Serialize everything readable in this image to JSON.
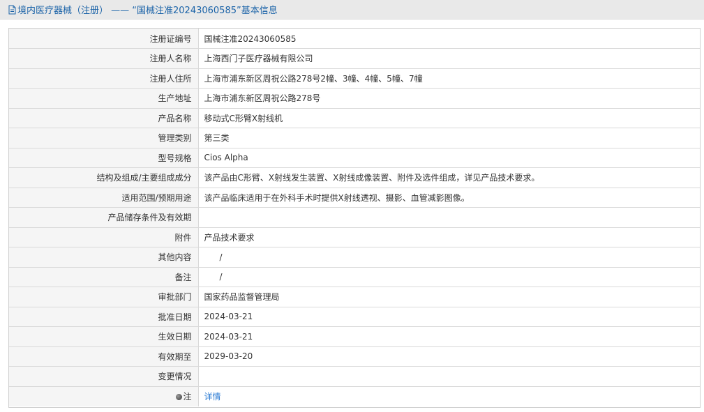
{
  "header": {
    "title": "境内医疗器械（注册） —— “国械注准20243060585”基本信息",
    "accent_color": "#1b63a8"
  },
  "rows": [
    {
      "label": "注册证编号",
      "value": "国械注准20243060585"
    },
    {
      "label": "注册人名称",
      "value": "上海西门子医疗器械有限公司"
    },
    {
      "label": "注册人住所",
      "value": "上海市浦东新区周祝公路278号2幢、3幢、4幢、5幢、7幢"
    },
    {
      "label": "生产地址",
      "value": "上海市浦东新区周祝公路278号"
    },
    {
      "label": "产品名称",
      "value": "移动式C形臂X射线机"
    },
    {
      "label": "管理类别",
      "value": "第三类"
    },
    {
      "label": "型号规格",
      "value": "Cios Alpha"
    },
    {
      "label": "结构及组成/主要组成成分",
      "value": "该产品由C形臂、X射线发生装置、X射线成像装置、附件及选件组成，详见产品技术要求。"
    },
    {
      "label": "适用范围/预期用途",
      "value": "该产品临床适用于在外科手术时提供X射线透视、摄影、血管减影图像。"
    },
    {
      "label": "产品储存条件及有效期",
      "value": ""
    },
    {
      "label": "附件",
      "value": "产品技术要求"
    },
    {
      "label": "其他内容",
      "value": "/"
    },
    {
      "label": "备注",
      "value": "/"
    },
    {
      "label": "审批部门",
      "value": "国家药品监督管理局"
    },
    {
      "label": "批准日期",
      "value": "2024-03-21"
    },
    {
      "label": "生效日期",
      "value": "2024-03-21"
    },
    {
      "label": "有效期至",
      "value": "2029-03-20"
    },
    {
      "label": "变更情况",
      "value": ""
    }
  ],
  "note": {
    "label": "注",
    "link_text": "详情",
    "link_color": "#2b7bd3",
    "icon": "globe-icon"
  }
}
